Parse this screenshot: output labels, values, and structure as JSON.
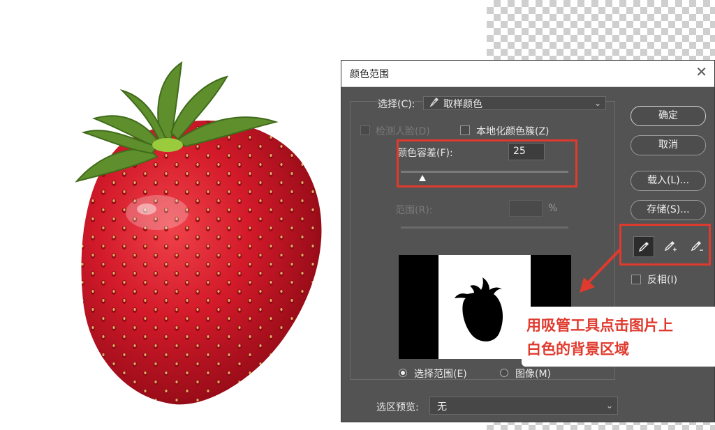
{
  "dialog": {
    "title": "颜色范围",
    "select_label": "选择(C):",
    "select_value": "取样颜色",
    "detect_faces_label": "检测人脸(D)",
    "localized_clusters_label": "本地化颜色簇(Z)",
    "fuzziness_label": "颜色容差(F):",
    "fuzziness_value": "25",
    "fuzziness_level": 0.13,
    "range_label": "范围(R):",
    "range_unit": "%",
    "selection_radio_label": "选择范围(E)",
    "image_radio_label": "图像(M)",
    "selection_preview_label": "选区预览:",
    "selection_preview_value": "无",
    "invert_label": "反相(I)",
    "buttons": {
      "ok": "确定",
      "cancel": "取消",
      "load": "载入(L)...",
      "save": "存储(S)..."
    },
    "eyedroppers": [
      "eyedropper-icon",
      "eyedropper-plus-icon",
      "eyedropper-minus-icon"
    ]
  },
  "annotation": {
    "line1": "用吸管工具点击图片上",
    "line2": "白色的背景区域"
  },
  "colors": {
    "highlight_red": "#e03a2e",
    "dialog_bg": "#535353"
  }
}
